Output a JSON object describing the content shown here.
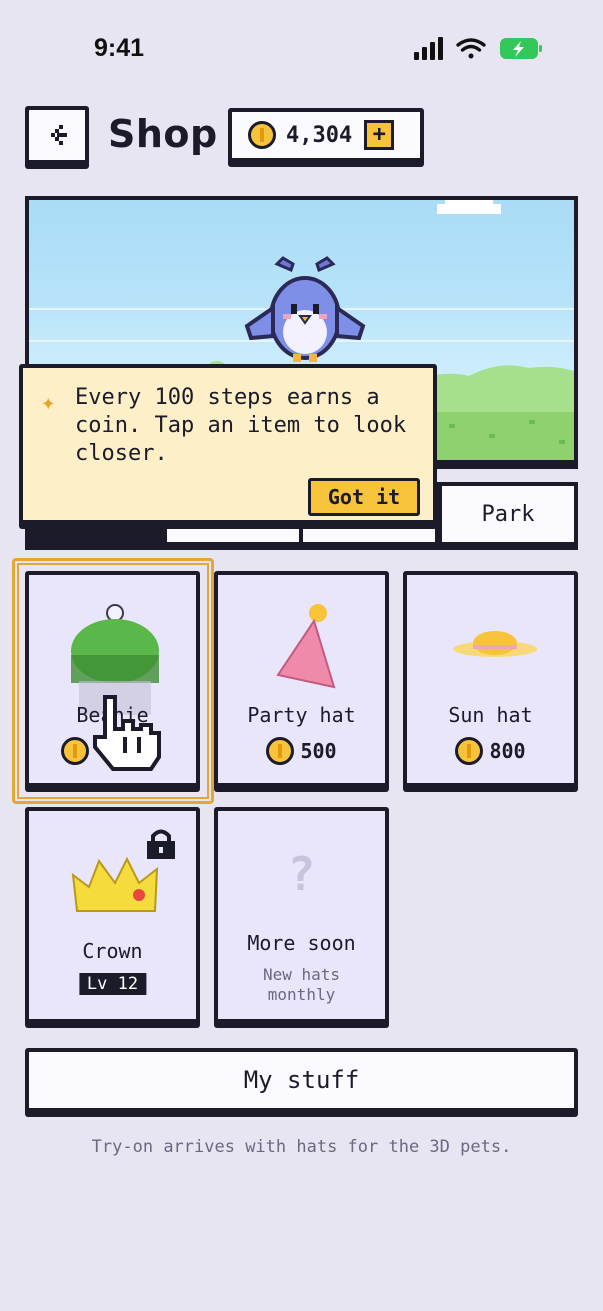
{
  "status_bar": {
    "time": "9:41"
  },
  "header": {
    "title": "Shop",
    "coins": "4,304",
    "add_label": "+"
  },
  "tooltip": {
    "text": "Every 100 steps earns a coin. Tap an item to look closer.",
    "button": "Got it"
  },
  "tabs": [
    {
      "label": ""
    },
    {
      "label": ""
    },
    {
      "label": ""
    },
    {
      "label": "Park"
    }
  ],
  "items": [
    {
      "name": "Beanie",
      "price": "",
      "selected": true
    },
    {
      "name": "Party hat",
      "price": "500"
    },
    {
      "name": "Sun hat",
      "price": "800"
    },
    {
      "name": "Crown",
      "level": "Lv 12",
      "locked": true
    },
    {
      "name": "More soon",
      "subtitle": "New hats monthly",
      "icon": "?"
    }
  ],
  "my_stuff": "My stuff",
  "footer": "Try-on arrives with hats for the 3D pets.",
  "colors": {
    "background": "#e7e5f2",
    "accent": "#f6c33a",
    "ink": "#1c1b29",
    "card": "#e9e5fb",
    "tooltip": "#fdf0c8"
  }
}
